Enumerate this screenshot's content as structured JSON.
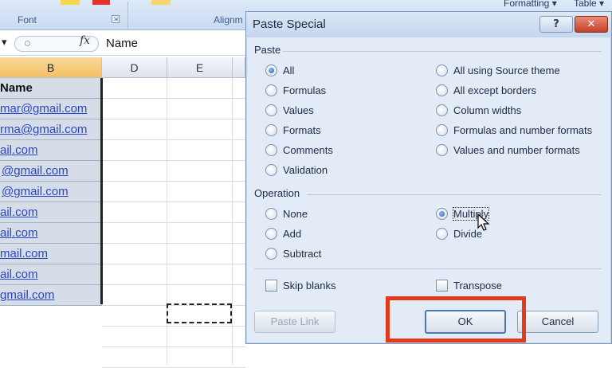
{
  "ribbon": {
    "font_group": "Font",
    "alignment_group": "Alignm",
    "formatting_label": "Formatting",
    "table_label": "Table"
  },
  "formula_bar": {
    "fx": "fx",
    "value": "Name"
  },
  "columns": [
    "B",
    "D",
    "E"
  ],
  "column_b_cells": [
    "Name",
    "mar@gmail.com",
    "rma@gmail.com",
    "ail.com",
    "@gmail.com",
    "@gmail.com",
    "ail.com",
    "ail.com",
    "mail.com",
    "ail.com",
    "gmail.com"
  ],
  "dialog": {
    "title": "Paste Special",
    "help_icon": "?",
    "paste_section": "Paste",
    "paste_left": [
      "All",
      "Formulas",
      "Values",
      "Formats",
      "Comments",
      "Validation"
    ],
    "paste_right": [
      "All using Source theme",
      "All except borders",
      "Column widths",
      "Formulas and number formats",
      "Values and number formats"
    ],
    "paste_selected": "All",
    "operation_section": "Operation",
    "operation_left": [
      "None",
      "Add",
      "Subtract"
    ],
    "operation_right": [
      "Multiply",
      "Divide"
    ],
    "operation_selected": "Multiply",
    "skip_blanks": "Skip blanks",
    "transpose": "Transpose",
    "paste_link": "Paste Link",
    "ok": "OK",
    "cancel": "Cancel"
  },
  "colors": {
    "highlight": "#e23a1c",
    "link": "#2a45c8",
    "selected_header": "#f3bf63"
  }
}
